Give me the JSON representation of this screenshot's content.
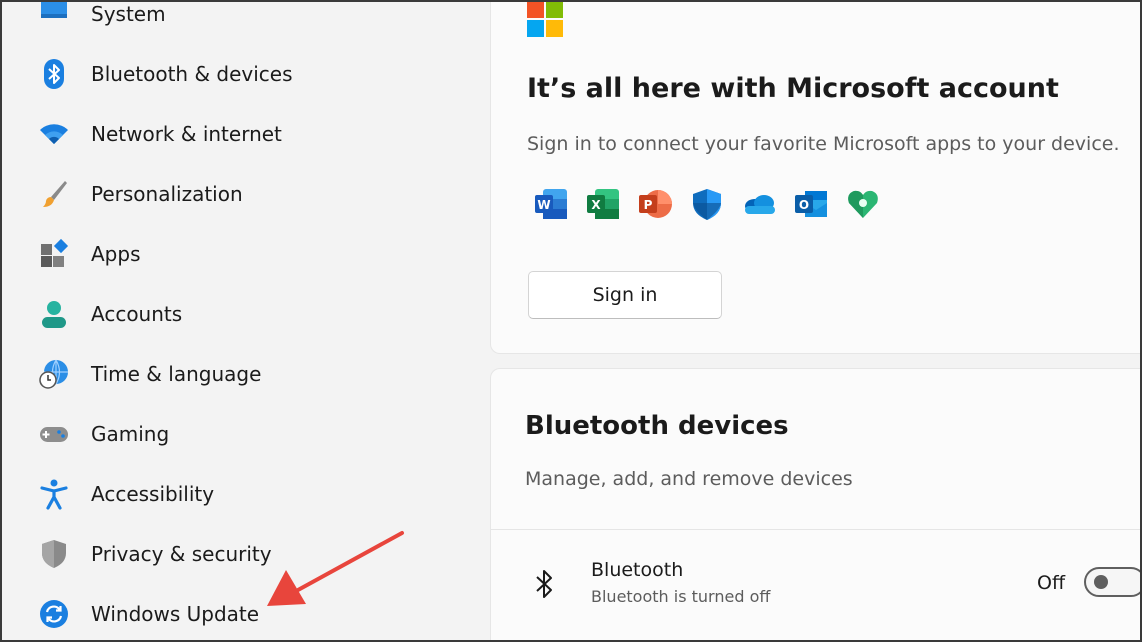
{
  "sidebar": {
    "items": [
      {
        "label": "System",
        "icon": "monitor-icon"
      },
      {
        "label": "Bluetooth & devices",
        "icon": "bluetooth-icon"
      },
      {
        "label": "Network & internet",
        "icon": "wifi-icon"
      },
      {
        "label": "Personalization",
        "icon": "paintbrush-icon"
      },
      {
        "label": "Apps",
        "icon": "apps-icon"
      },
      {
        "label": "Accounts",
        "icon": "person-icon"
      },
      {
        "label": "Time & language",
        "icon": "globe-clock-icon"
      },
      {
        "label": "Gaming",
        "icon": "gamepad-icon"
      },
      {
        "label": "Accessibility",
        "icon": "accessibility-icon"
      },
      {
        "label": "Privacy & security",
        "icon": "shield-icon"
      },
      {
        "label": "Windows Update",
        "icon": "sync-icon"
      }
    ]
  },
  "microsoft_account": {
    "title": "It’s all here with Microsoft account",
    "subtitle": "Sign in to connect your favorite Microsoft apps to your device.",
    "apps": [
      "word-icon",
      "excel-icon",
      "powerpoint-icon",
      "defender-icon",
      "onedrive-icon",
      "outlook-icon",
      "family-icon"
    ],
    "signin_label": "Sign in"
  },
  "bluetooth_devices": {
    "title": "Bluetooth devices",
    "subtitle": "Manage, add, and remove devices",
    "bluetooth_row": {
      "title": "Bluetooth",
      "status": "Bluetooth is turned off",
      "toggle_label": "Off",
      "toggle_on": false
    }
  },
  "colors": {
    "accent": "#0067c0",
    "annotation_arrow": "#e8453c"
  }
}
